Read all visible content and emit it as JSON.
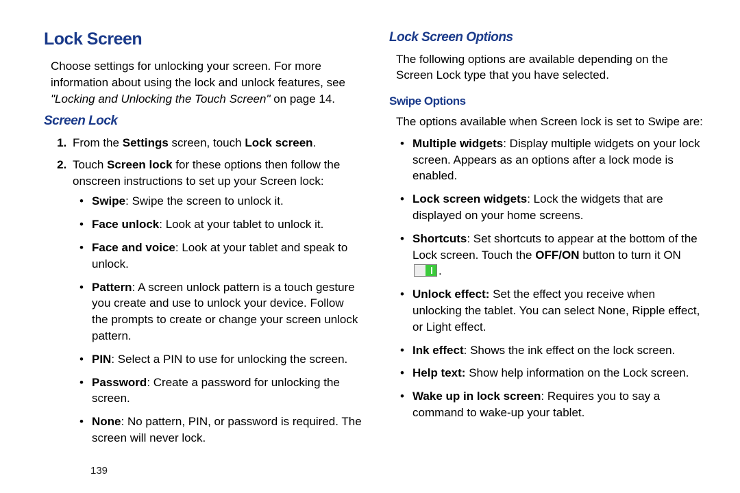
{
  "page_number": "139",
  "left": {
    "h1": "Lock Screen",
    "intro1": "Choose settings for unlocking your screen. For more information about using the lock and unlock features, see ",
    "crossref": "\"Locking and Unlocking the Touch Screen\"",
    "crossref_tail": " on page 14.",
    "h2": "Screen Lock",
    "step1_pre": "From the ",
    "step1_b1": "Settings",
    "step1_mid": " screen, touch ",
    "step1_b2": "Lock screen",
    "step1_tail": ".",
    "step2_pre": "Touch ",
    "step2_b1": "Screen lock",
    "step2_tail": " for these options then follow the onscreen instructions to set up your Screen lock:",
    "opts": {
      "swipe_b": "Swipe",
      "swipe_t": ": Swipe the screen to unlock it.",
      "face_b": "Face unlock",
      "face_t": ": Look at your tablet to unlock it.",
      "fv_b": "Face and voice",
      "fv_t": ": Look at your tablet and speak to unlock.",
      "pattern_b": "Pattern",
      "pattern_t": ": A screen unlock pattern is a touch gesture you create and use to unlock your device. Follow the prompts to create or change your screen unlock pattern.",
      "pin_b": "PIN",
      "pin_t": ": Select a PIN to use for unlocking the screen.",
      "pwd_b": "Password",
      "pwd_t": ": Create a password for unlocking the screen.",
      "none_b": "None",
      "none_t": ": No pattern, PIN, or password is required. The screen will never lock."
    }
  },
  "right": {
    "h2": "Lock Screen Options",
    "intro": "The following options are available depending on the Screen Lock type that you have selected.",
    "h3": "Swipe Options",
    "lead": "The options available when Screen lock is set to Swipe are:",
    "items": {
      "mw_b": "Multiple widgets",
      "mw_t": ": Display multiple widgets on your lock screen. Appears as an options after a lock mode is enabled.",
      "lsw_b": "Lock screen widgets",
      "lsw_t": ": Lock the widgets that are displayed on your home screens.",
      "sc_b": "Shortcuts",
      "sc_t1": ": Set shortcuts to appear at the bottom of the Lock screen. Touch the ",
      "sc_b2": "OFF/ON",
      "sc_t2": " button to turn it ON ",
      "sc_tail": ".",
      "ue_b": "Unlock effect:",
      "ue_t": " Set the effect you receive when unlocking the tablet. You can select None, Ripple effect, or Light effect.",
      "ink_b": "Ink effect",
      "ink_t": ": Shows the ink effect on the lock screen.",
      "ht_b": "Help text:",
      "ht_t": " Show help information on the Lock screen.",
      "wu_b": "Wake up in lock screen",
      "wu_t": ": Requires you to say a command to wake-up your tablet."
    }
  }
}
